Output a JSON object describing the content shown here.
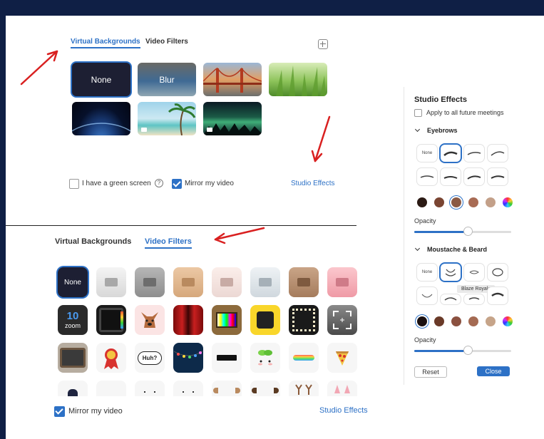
{
  "top": {
    "tabs": [
      "Virtual Backgrounds",
      "Video Filters"
    ],
    "thumb_none": "None",
    "thumb_blur": "Blur",
    "green_screen_label": "I have a green screen",
    "mirror_label": "Mirror my video",
    "studio_effects_link": "Studio Effects"
  },
  "bottom": {
    "tabs": [
      "Virtual Backgrounds",
      "Video Filters"
    ],
    "filter_none": "None",
    "mirror_label": "Mirror my video",
    "studio_effects_link": "Studio Effects"
  },
  "filter_text": {
    "zoom_ten": "10",
    "zoom_word": "zoom",
    "huh": "Huh?"
  },
  "studio": {
    "title": "Studio Effects",
    "apply_label": "Apply to all future meetings",
    "eyebrows_label": "Eyebrows",
    "eyebrow_none": "None",
    "opacity_label_1": "Opacity",
    "moustache_label": "Moustache & Beard",
    "moustache_none": "None",
    "tooltip": "Blaze Royale",
    "opacity_label_2": "Opacity",
    "reset_label": "Reset",
    "close_label": "Close",
    "eyebrow_colors": [
      "#2b1a14",
      "#7a4532",
      "#8b5a44",
      "#a86b54",
      "#c3a089"
    ],
    "beard_colors": [
      "#1a1010",
      "#6a3a28",
      "#8b5140",
      "#a46a52",
      "#c6a489"
    ],
    "eyebrow_opacity": 0.55,
    "beard_opacity": 0.55
  }
}
